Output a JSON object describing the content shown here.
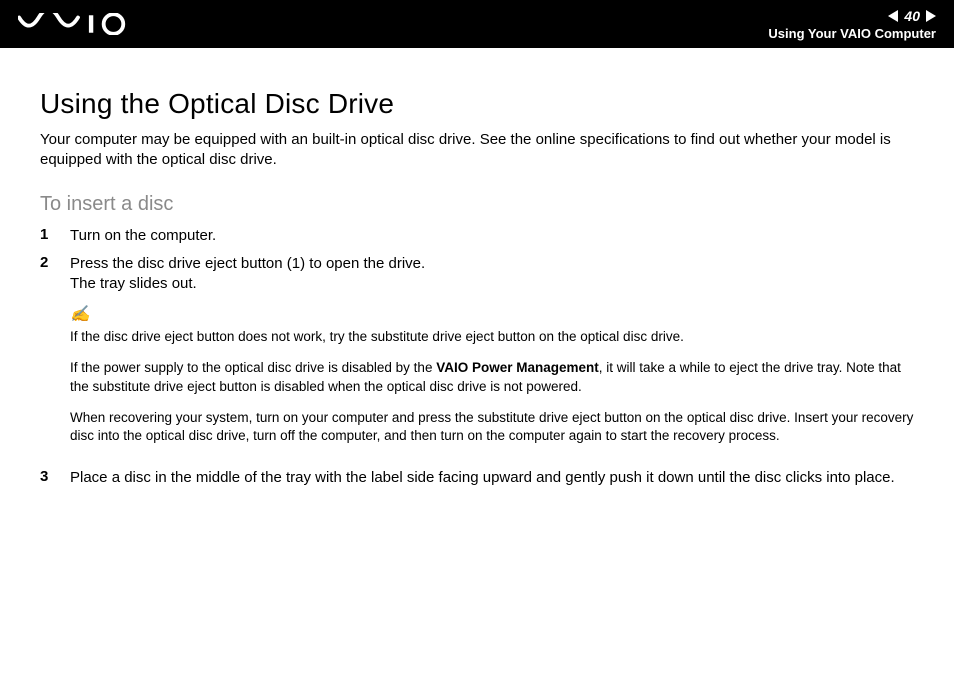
{
  "header": {
    "page_number": "40",
    "section": "Using Your VAIO Computer"
  },
  "title": "Using the Optical Disc Drive",
  "intro": "Your computer may be equipped with an built-in optical disc drive. See the online specifications to find out whether your model is equipped with the optical disc drive.",
  "subheading": "To insert a disc",
  "steps": {
    "s1": {
      "num": "1",
      "text": "Turn on the computer."
    },
    "s2": {
      "num": "2",
      "line1": "Press the disc drive eject button (1) to open the drive.",
      "line2": "The tray slides out."
    },
    "note": {
      "icon": "✍",
      "n1": "If the disc drive eject button does not work, try the substitute drive eject button on the optical disc drive.",
      "n2a": "If the power supply to the optical disc drive is disabled by the ",
      "n2b": "VAIO Power Management",
      "n2c": ", it will take a while to eject the drive tray. Note that the substitute drive eject button is disabled when the optical disc drive is not powered.",
      "n3": "When recovering your system, turn on your computer and press the substitute drive eject button on the optical disc drive. Insert your recovery disc into the optical disc drive, turn off the computer, and then turn on the computer again to start the recovery process."
    },
    "s3": {
      "num": "3",
      "text": "Place a disc in the middle of the tray with the label side facing upward and gently push it down until the disc clicks into place."
    }
  }
}
